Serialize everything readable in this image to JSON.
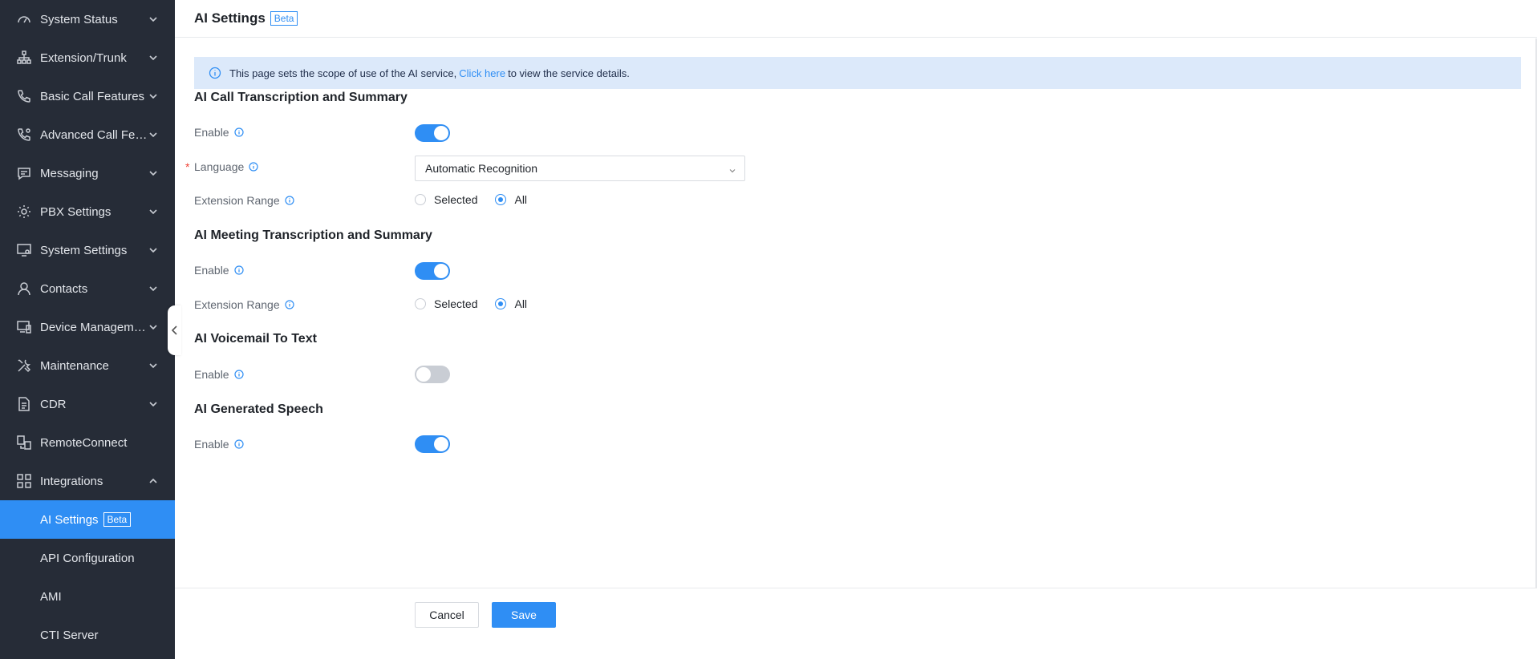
{
  "sidebar": {
    "items": [
      {
        "label": "System Status",
        "icon": "gauge-icon"
      },
      {
        "label": "Extension/Trunk",
        "icon": "network-icon"
      },
      {
        "label": "Basic Call Features",
        "icon": "phone-icon"
      },
      {
        "label": "Advanced Call Feat...",
        "icon": "phone-settings-icon"
      },
      {
        "label": "Messaging",
        "icon": "message-icon"
      },
      {
        "label": "PBX Settings",
        "icon": "gear-icon"
      },
      {
        "label": "System Settings",
        "icon": "monitor-settings-icon"
      },
      {
        "label": "Contacts",
        "icon": "person-icon"
      },
      {
        "label": "Device Management",
        "icon": "devices-icon"
      },
      {
        "label": "Maintenance",
        "icon": "tools-icon"
      },
      {
        "label": "CDR",
        "icon": "document-icon"
      },
      {
        "label": "RemoteConnect",
        "icon": "remote-icon"
      },
      {
        "label": "Integrations",
        "icon": "grid-icon"
      }
    ],
    "sub_items": [
      {
        "label": "AI Settings",
        "badge": "Beta"
      },
      {
        "label": "API Configuration"
      },
      {
        "label": "AMI"
      },
      {
        "label": "CTI Server"
      }
    ]
  },
  "header": {
    "title": "AI Settings",
    "badge": "Beta"
  },
  "banner": {
    "text_before": "This page sets the scope of use of the AI service,",
    "link": "Click here",
    "text_after": "to view the service details."
  },
  "sections": {
    "call": {
      "title": "AI Call Transcription and Summary",
      "enable_label": "Enable",
      "enabled": true,
      "language_label": "Language",
      "language_value": "Automatic Recognition",
      "range_label": "Extension Range",
      "range_options": [
        "Selected",
        "All"
      ],
      "range_selected": "All"
    },
    "meeting": {
      "title": "AI Meeting Transcription and Summary",
      "enable_label": "Enable",
      "enabled": true,
      "range_label": "Extension Range",
      "range_options": [
        "Selected",
        "All"
      ],
      "range_selected": "All"
    },
    "voicemail": {
      "title": "AI Voicemail To Text",
      "enable_label": "Enable",
      "enabled": false
    },
    "speech": {
      "title": "AI Generated Speech",
      "enable_label": "Enable",
      "enabled": true
    }
  },
  "footer": {
    "cancel_label": "Cancel",
    "save_label": "Save"
  },
  "colors": {
    "accent": "#2f8ef4",
    "sidebar_bg": "#262c37",
    "banner_bg": "#dce9fa",
    "required": "#f04134"
  }
}
